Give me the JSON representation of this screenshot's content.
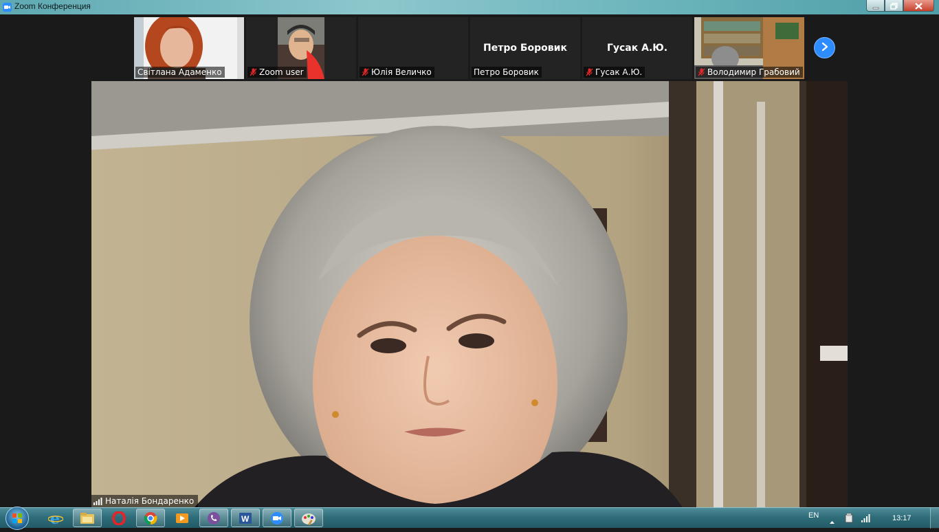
{
  "window": {
    "title": "Zoom Конференция",
    "controls": [
      "minimize-icon",
      "restore-icon",
      "close-icon"
    ]
  },
  "gallery": {
    "tiles": [
      {
        "name": "Світлана Адаменко",
        "muted": false,
        "video": true
      },
      {
        "name": "Zoom user",
        "muted": true,
        "video": true
      },
      {
        "name": "Юлія Величко",
        "muted": true,
        "video": false,
        "center_name": ""
      },
      {
        "name": "Петро Боровик",
        "muted": false,
        "video": false,
        "center_name": "Петро Боровик"
      },
      {
        "name": "Гусак А.Ю.",
        "muted": true,
        "video": false,
        "center_name": "Гусак А.Ю."
      },
      {
        "name": "Володимир Грабовий",
        "muted": true,
        "video": true
      }
    ],
    "next_icon": "chevron-right-icon"
  },
  "active_speaker": {
    "name": "Наталія Бондаренко",
    "signal_icon": "signal-bars-icon"
  },
  "taskbar": {
    "items": [
      "windows-start",
      "internet-explorer",
      "file-explorer",
      "opera",
      "chrome",
      "media-player",
      "viber",
      "word",
      "zoom",
      "paint"
    ],
    "active_item": "zoom",
    "language": "EN",
    "time": "13:17"
  },
  "colors": {
    "zoom_blue": "#2d8cff",
    "mute_red": "#e02828",
    "titlebar": "#6bb4bb",
    "background": "#1a1a1a"
  }
}
